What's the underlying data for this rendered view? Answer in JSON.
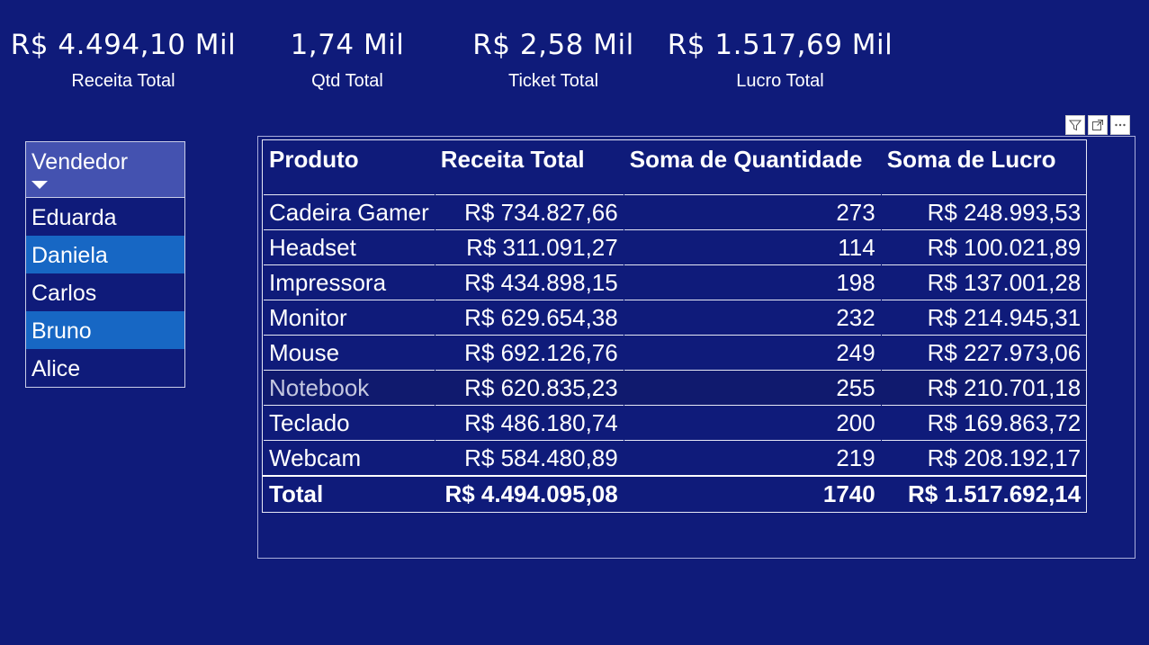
{
  "kpis": {
    "receita": {
      "value": "R$ 4.494,10 Mil",
      "label": "Receita Total"
    },
    "qtd": {
      "value": "1,74 Mil",
      "label": "Qtd Total"
    },
    "ticket": {
      "value": "R$ 2,58 Mil",
      "label": "Ticket Total"
    },
    "lucro": {
      "value": "R$ 1.517,69 Mil",
      "label": "Lucro Total"
    }
  },
  "slicer": {
    "title": "Vendedor",
    "items": [
      {
        "label": "Eduarda",
        "selected": false
      },
      {
        "label": "Daniela",
        "selected": true
      },
      {
        "label": "Carlos",
        "selected": false
      },
      {
        "label": "Bruno",
        "selected": true
      },
      {
        "label": "Alice",
        "selected": false
      }
    ]
  },
  "visual_header_icons": [
    "filter-icon",
    "focus-mode-icon",
    "more-options-icon"
  ],
  "table": {
    "columns": [
      "Produto",
      "Receita Total",
      "Soma de Quantidade",
      "Soma de Lucro"
    ],
    "rows": [
      [
        "Cadeira Gamer",
        "R$ 734.827,66",
        "273",
        "R$ 248.993,53"
      ],
      [
        "Headset",
        "R$ 311.091,27",
        "114",
        "R$ 100.021,89"
      ],
      [
        "Impressora",
        "R$ 434.898,15",
        "198",
        "R$ 137.001,28"
      ],
      [
        "Monitor",
        "R$ 629.654,38",
        "232",
        "R$ 214.945,31"
      ],
      [
        "Mouse",
        "R$ 692.126,76",
        "249",
        "R$ 227.973,06"
      ],
      [
        "Notebook",
        "R$ 620.835,23",
        "255",
        "R$ 210.701,18"
      ],
      [
        "Teclado",
        "R$ 486.180,74",
        "200",
        "R$ 169.863,72"
      ],
      [
        "Webcam",
        "R$ 584.480,89",
        "219",
        "R$ 208.192,17"
      ]
    ],
    "total": [
      "Total",
      "R$ 4.494.095,08",
      "1740",
      "R$ 1.517.692,14"
    ]
  },
  "colors": {
    "background": "#0f1b7a",
    "slicer_header": "#4452b0",
    "slicer_selected": "#1767c4"
  }
}
